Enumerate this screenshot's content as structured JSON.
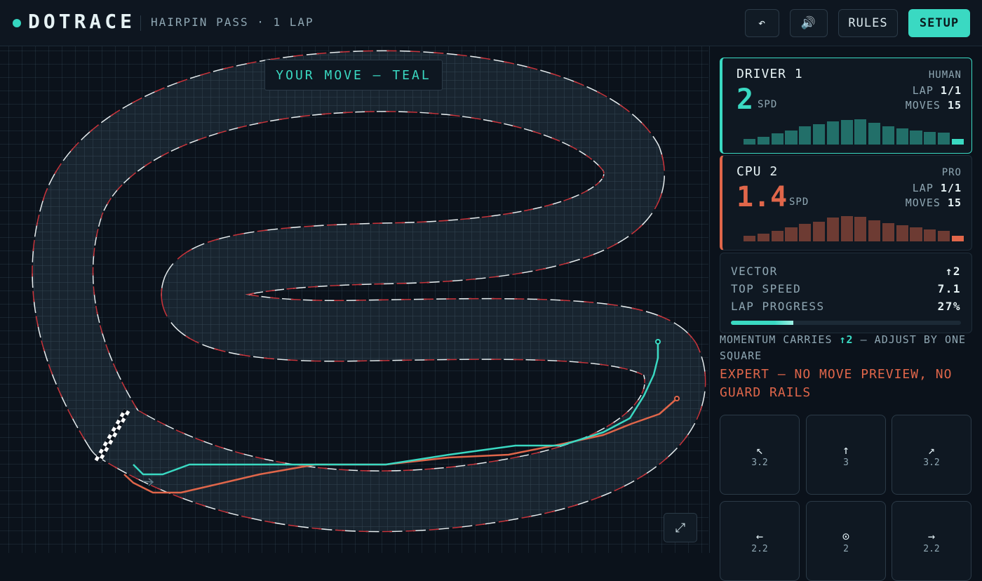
{
  "header": {
    "logo": "DOTRACE",
    "track": "HAIRPIN PASS · 1 LAP",
    "undo_icon": "↶",
    "sound_icon": "🔊",
    "rules_label": "RULES",
    "setup_label": "SETUP"
  },
  "board": {
    "turn_banner": "YOUR MOVE — TEAL",
    "expand_icon": "⤢",
    "colors": {
      "teal": "#3ad9c2",
      "red": "#e0664a",
      "kerb_red": "#c8333a",
      "kerb_white": "#e8eef0"
    }
  },
  "players": [
    {
      "name": "DRIVER 1",
      "type": "HUMAN",
      "speed": "2",
      "speed_unit": "SPD",
      "lap_label": "LAP",
      "lap": "1/1",
      "moves_label": "MOVES",
      "moves": "15",
      "color": "#3ad9c2",
      "speed_history": [
        1,
        1.4,
        2.1,
        2.7,
        3.5,
        3.8,
        4.4,
        4.7,
        4.8,
        4.1,
        3.5,
        3.0,
        2.6,
        2.4,
        2.2,
        1.0
      ]
    },
    {
      "name": "CPU 2",
      "type": "PRO",
      "speed": "1.4",
      "speed_unit": "SPD",
      "lap_label": "LAP",
      "lap": "1/1",
      "moves_label": "MOVES",
      "moves": "15",
      "color": "#e0664a",
      "speed_history": [
        1,
        1.4,
        2.0,
        2.7,
        3.3,
        3.7,
        4.5,
        4.8,
        4.7,
        4.0,
        3.5,
        3.0,
        2.6,
        2.3,
        2.0,
        1.0
      ]
    }
  ],
  "stats": {
    "vector_label": "VECTOR",
    "vector": "↑2",
    "top_speed_label": "TOP SPEED",
    "top_speed": "7.1",
    "progress_label": "LAP PROGRESS",
    "progress": "27%",
    "progress_value": 0.27
  },
  "hint": {
    "prefix": "MOMENTUM CARRIES ",
    "vector": "↑2",
    "suffix": " — ADJUST BY ONE SQUARE"
  },
  "expert_note": "EXPERT — NO MOVE PREVIEW, NO GUARD RAILS",
  "moves": [
    {
      "icon": "↖",
      "value": "3.2"
    },
    {
      "icon": "↑",
      "value": "3"
    },
    {
      "icon": "↗",
      "value": "3.2"
    },
    {
      "icon": "←",
      "value": "2.2"
    },
    {
      "icon": "⊙",
      "value": "2"
    },
    {
      "icon": "→",
      "value": "2.2"
    }
  ]
}
